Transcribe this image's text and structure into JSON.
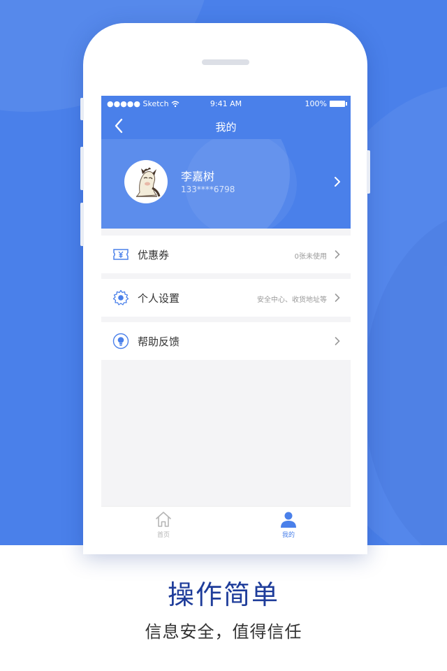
{
  "status_bar": {
    "carrier": "●●●●● Sketch",
    "time": "9:41 AM",
    "battery": "100%"
  },
  "nav": {
    "title": "我的",
    "back_icon": "chevron-left-icon"
  },
  "profile": {
    "name": "李嘉树",
    "phone": "133****6798",
    "avatar": "cartoon-horse-avatar"
  },
  "menu": {
    "coupon": {
      "label": "优惠券",
      "hint": "0张未使用",
      "icon": "coupon-icon"
    },
    "settings": {
      "label": "个人设置",
      "hint": "安全中心、收货地址等",
      "icon": "gear-icon"
    },
    "help": {
      "label": "帮助反馈",
      "hint": "",
      "icon": "lightbulb-icon"
    }
  },
  "tabs": [
    {
      "label": "首页",
      "icon": "home-icon",
      "active": false
    },
    {
      "label": "我的",
      "icon": "user-icon",
      "active": true
    }
  ],
  "caption": {
    "title": "操作简单",
    "subtitle": "信息安全，值得信任"
  },
  "colors": {
    "primary": "#4a80ea",
    "caption_title": "#1e3c9a",
    "tab_inactive": "#b5b5b5"
  }
}
